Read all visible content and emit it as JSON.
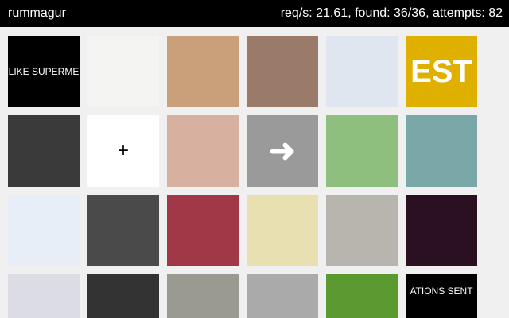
{
  "header": {
    "app_title": "rummagur",
    "stats": "req/s: 21.61, found: 36/36, attempts: 82"
  },
  "tiles": [
    {
      "color": "#000000",
      "text": "LIKE SUPERME",
      "style": ""
    },
    {
      "color": "#f4f4f2",
      "text": "",
      "style": ""
    },
    {
      "color": "#c9a07a",
      "text": "",
      "style": ""
    },
    {
      "color": "#9a7a68",
      "text": "",
      "style": ""
    },
    {
      "color": "#dfe6f0",
      "text": "",
      "style": ""
    },
    {
      "color": "#e0b000",
      "text": "EST",
      "style": "big"
    },
    {
      "color": "#3a3a3a",
      "text": "",
      "style": ""
    },
    {
      "color": "#ffffff",
      "text": "+",
      "style": "dark"
    },
    {
      "color": "#d8b0a0",
      "text": "",
      "style": ""
    },
    {
      "color": "#9a9a9a",
      "text": "➜",
      "style": "big"
    },
    {
      "color": "#8fbf7f",
      "text": "",
      "style": ""
    },
    {
      "color": "#7aa8a8",
      "text": "",
      "style": ""
    },
    {
      "color": "#e8eef8",
      "text": "",
      "style": ""
    },
    {
      "color": "#4a4a4a",
      "text": "",
      "style": ""
    },
    {
      "color": "#a03848",
      "text": "",
      "style": ""
    },
    {
      "color": "#e8e0b0",
      "text": "",
      "style": ""
    },
    {
      "color": "#b8b4ae",
      "text": "",
      "style": ""
    },
    {
      "color": "#2a1020",
      "text": "",
      "style": ""
    },
    {
      "color": "#dcdce4",
      "text": "",
      "style": ""
    },
    {
      "color": "#333333",
      "text": "",
      "style": ""
    },
    {
      "color": "#9a9a90",
      "text": "",
      "style": ""
    },
    {
      "color": "#aaaaaa",
      "text": "",
      "style": ""
    },
    {
      "color": "#5a9a30",
      "text": "",
      "style": ""
    },
    {
      "color": "#000000",
      "text": "ATIONS SENT",
      "style": ""
    }
  ]
}
